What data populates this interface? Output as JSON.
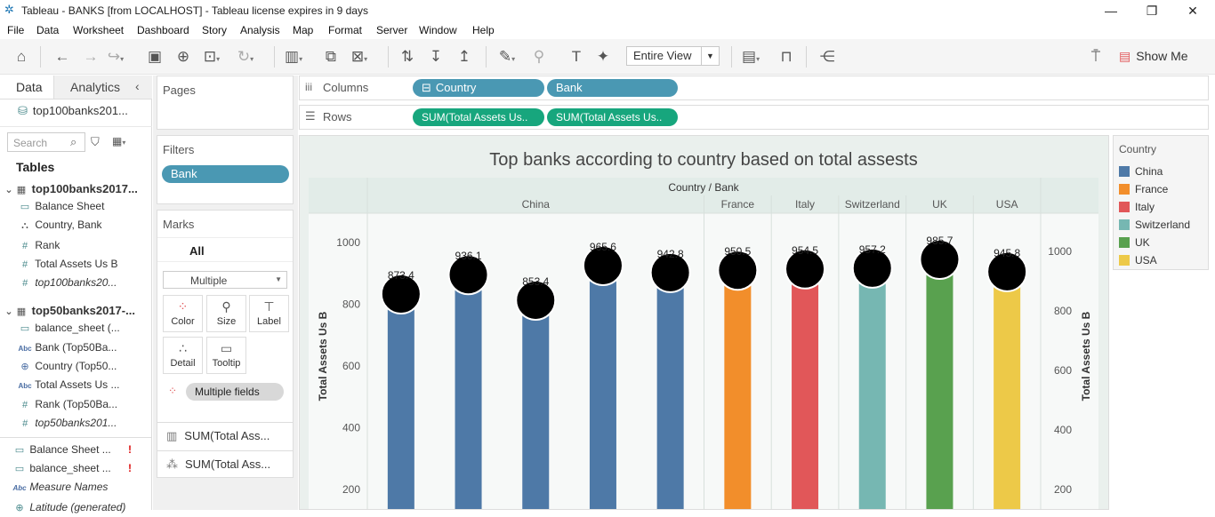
{
  "window": {
    "title": "Tableau - BANKS [from LOCALHOST] - Tableau license expires in 9 days"
  },
  "menu": [
    "File",
    "Data",
    "Worksheet",
    "Dashboard",
    "Story",
    "Analysis",
    "Map",
    "Format",
    "Server",
    "Window",
    "Help"
  ],
  "toolbar": {
    "fit": "Entire View",
    "show_me": "Show Me"
  },
  "left": {
    "tab_data": "Data",
    "tab_analytics": "Analytics",
    "datasource": "top100banks201...",
    "search_placeholder": "Search",
    "tables_heading": "Tables",
    "table1": {
      "name": "top100banks2017...",
      "fields": [
        "Balance Sheet",
        "Country, Bank",
        "Rank",
        "Total Assets Us B",
        "top100banks20..."
      ]
    },
    "table2": {
      "name": "top50banks2017-...",
      "fields": [
        "balance_sheet (...",
        "Bank (Top50Ba...",
        "Country (Top50...",
        "Total Assets Us ...",
        "Rank (Top50Ba...",
        "top50banks201..."
      ]
    },
    "extra": [
      "Balance Sheet ...",
      "balance_sheet ...",
      "Measure Names",
      "Latitude (generated)"
    ],
    "excl": "!"
  },
  "pages": {
    "label": "Pages"
  },
  "filters": {
    "label": "Filters",
    "pill": "Bank"
  },
  "marks": {
    "label": "Marks",
    "all": "All",
    "type": "Multiple",
    "color": "Color",
    "size": "Size",
    "label_btn": "Label",
    "detail": "Detail",
    "tooltip": "Tooltip",
    "multiple_fields": "Multiple fields",
    "sum1": "SUM(Total Ass...",
    "sum2": "SUM(Total Ass..."
  },
  "shelves": {
    "columns_label": "Columns",
    "rows_label": "Rows",
    "col_pills": [
      "Country",
      "Bank"
    ],
    "row_pills": [
      "SUM(Total Assets Us..",
      "SUM(Total Assets Us.."
    ]
  },
  "legend": {
    "title": "Country",
    "items": [
      {
        "name": "China",
        "color": "#4e79a7"
      },
      {
        "name": "France",
        "color": "#f28e2b"
      },
      {
        "name": "Italy",
        "color": "#e15759"
      },
      {
        "name": "Switzerland",
        "color": "#76b7b2"
      },
      {
        "name": "UK",
        "color": "#59a14f"
      },
      {
        "name": "USA",
        "color": "#edc948"
      }
    ]
  },
  "chart_data": {
    "type": "bar",
    "title": "Top banks according to country based on total assests",
    "header_title": "Country / Bank",
    "ylabel": "Total Assets Us B",
    "ylabel_right": "Total Assets Us B",
    "ylim": [
      0,
      1000
    ],
    "yticks_left": [
      200,
      400,
      600,
      800,
      1000
    ],
    "yticks_right": [
      200,
      400,
      600,
      800,
      1000
    ],
    "countries": [
      {
        "name": "China",
        "bars": 5
      },
      {
        "name": "France",
        "bars": 1
      },
      {
        "name": "Italy",
        "bars": 1
      },
      {
        "name": "Switzerland",
        "bars": 1
      },
      {
        "name": "UK",
        "bars": 1
      },
      {
        "name": "USA",
        "bars": 1
      }
    ],
    "values": [
      873.4,
      936.1,
      853.4,
      965.6,
      942.8,
      950.5,
      954.5,
      957.2,
      985.7,
      945.8
    ],
    "colors": [
      "#4e79a7",
      "#4e79a7",
      "#4e79a7",
      "#4e79a7",
      "#4e79a7",
      "#f28e2b",
      "#e15759",
      "#76b7b2",
      "#59a14f",
      "#edc948"
    ],
    "data_labels": [
      "873.4",
      "936.1",
      "853.4",
      "965.6",
      "942.8",
      "950.5",
      "954.5",
      "957.2",
      "985.7",
      "945.8"
    ]
  }
}
